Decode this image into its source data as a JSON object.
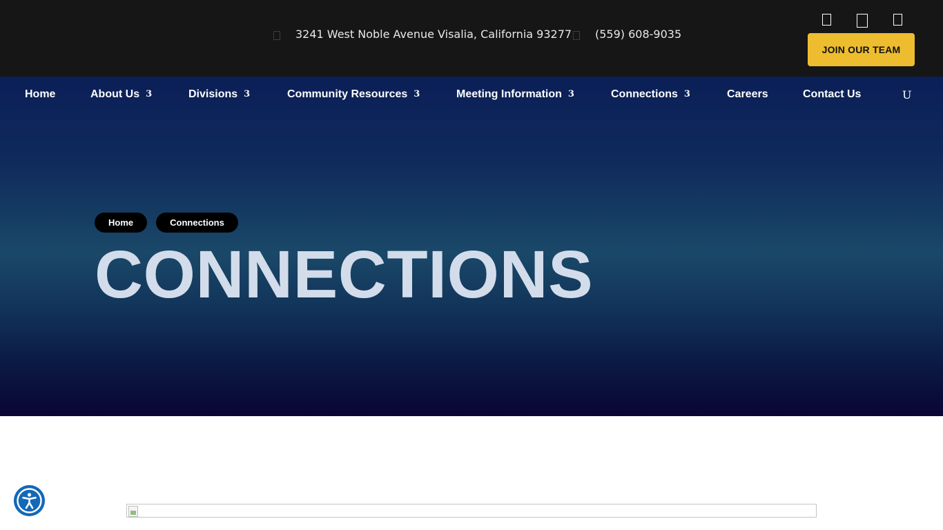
{
  "topbar": {
    "address": "3241 West Noble Avenue Visalia, California 93277",
    "phone": "(559) 608-9035",
    "address_icon": "map-marker-icon",
    "phone_icon": "phone-icon",
    "social_icons": [
      "facebook-icon",
      "instagram-icon",
      "linkedin-icon"
    ],
    "join_label": "JOIN OUR TEAM"
  },
  "nav": {
    "items": [
      {
        "label": "Home",
        "caret": ""
      },
      {
        "label": "About Us",
        "caret": "3"
      },
      {
        "label": "Divisions",
        "caret": "3"
      },
      {
        "label": "Community Resources",
        "caret": "3"
      },
      {
        "label": "Meeting Information",
        "caret": "3"
      },
      {
        "label": "Connections",
        "caret": "3"
      },
      {
        "label": "Careers",
        "caret": ""
      },
      {
        "label": "Contact Us",
        "caret": ""
      }
    ],
    "search_glyph": "U"
  },
  "hero": {
    "breadcrumb": [
      "Home",
      "Connections"
    ],
    "title": "CONNECTIONS"
  },
  "colors": {
    "topbar_bg": "#161616",
    "accent": "#edbd2f",
    "hero_top": "#0b1f57",
    "hero_bottom": "#0a0533",
    "title_color": "#d3dcea",
    "accessibility_blue": "#1468b8"
  }
}
